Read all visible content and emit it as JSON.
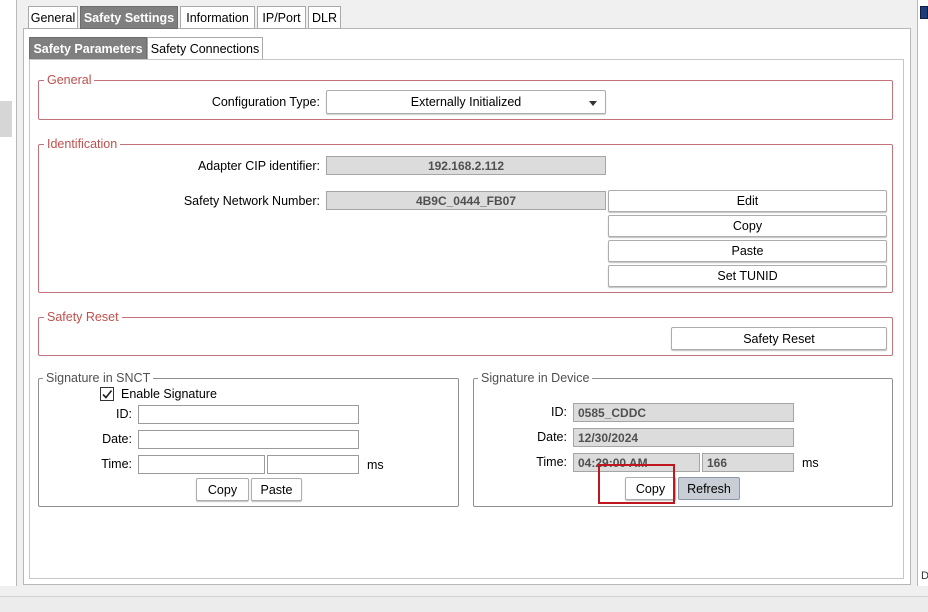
{
  "tabs": [
    "General",
    "Safety Settings",
    "Information",
    "IP/Port",
    "DLR"
  ],
  "subtabs": [
    "Safety Parameters",
    "Safety Connections"
  ],
  "general_group": {
    "legend": "General",
    "config_type_label": "Configuration Type:",
    "config_type_value": "Externally Initialized"
  },
  "identification_group": {
    "legend": "Identification",
    "adapter_label": "Adapter CIP identifier:",
    "adapter_value": "192.168.2.112",
    "snn_label": "Safety Network Number:",
    "snn_value": "4B9C_0444_FB07",
    "buttons": {
      "edit": "Edit",
      "copy": "Copy",
      "paste": "Paste",
      "set_tunid": "Set TUNID"
    }
  },
  "safety_reset_group": {
    "legend": "Safety Reset",
    "button": "Safety Reset"
  },
  "signature_snct": {
    "legend": "Signature in SNCT",
    "enable_label": "Enable Signature",
    "enable_checked": true,
    "id_label": "ID:",
    "date_label": "Date:",
    "time_label": "Time:",
    "ms_label": "ms",
    "id_value": "",
    "date_value": "",
    "time_value": "",
    "ms_value": "",
    "copy_button": "Copy",
    "paste_button": "Paste"
  },
  "signature_device": {
    "legend": "Signature in Device",
    "id_label": "ID:",
    "date_label": "Date:",
    "time_label": "Time:",
    "ms_label": "ms",
    "id_value": "0585_CDDC",
    "date_value": "12/30/2024",
    "time_value": "04:29:00 AM",
    "ms_value": "166",
    "copy_button": "Copy",
    "refresh_button": "Refresh"
  },
  "colors": {
    "red_group": "#c0504d",
    "active_tab": "#7f7f7f",
    "highlight": "#c0171f"
  }
}
